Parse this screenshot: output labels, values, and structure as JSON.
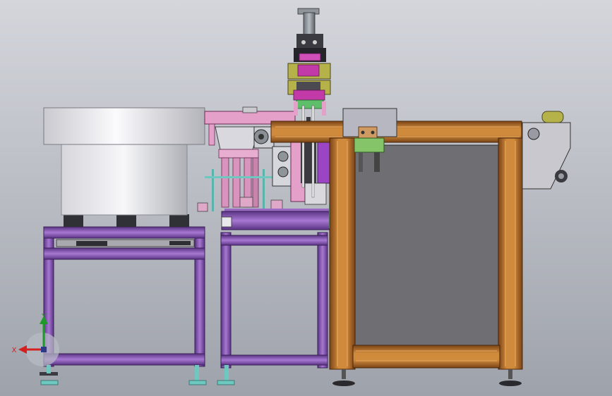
{
  "viewport": {
    "background_top": "#d4d6dc",
    "background_bottom": "#9ea2aa"
  },
  "colors": {
    "frame_purple": "#9b6bc4",
    "frame_purple_dark": "#4b2a6e",
    "frame_orange": "#c3782f",
    "frame_orange_dark": "#6b3a12",
    "panel_gray": "#6f6f73",
    "bowl_light": "#f2f2f4",
    "bowl_shade": "#b8b8be",
    "pink_part": "#e4a0c8",
    "magenta_part": "#c23aa8",
    "olive_part": "#b6b24a",
    "green_part": "#7fbf6a",
    "teal_foot": "#6ec8c0",
    "cylinder_gray": "#9aa0a6",
    "steel_dark": "#333338"
  },
  "triad": {
    "x_label": "X",
    "y_label": "Y",
    "x_color": "#d42020",
    "y_color": "#1f9a2a",
    "origin_icon": "axis-triad-icon"
  }
}
